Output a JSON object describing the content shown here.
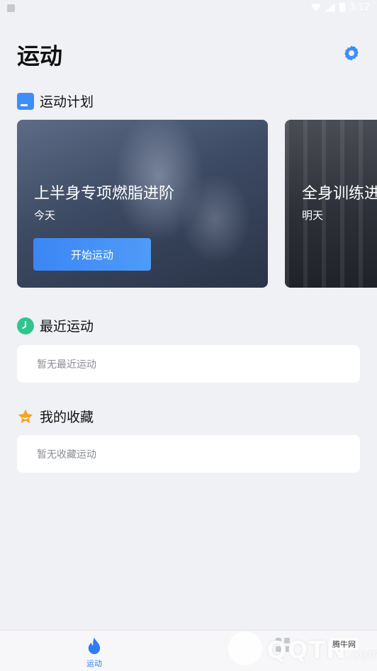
{
  "status_bar": {
    "time": "3:12"
  },
  "header": {
    "title": "运动",
    "settings_icon": "gear-icon"
  },
  "plan_section": {
    "title": "运动计划",
    "icon": "calendar-icon",
    "cards": [
      {
        "title": "上半身专项燃脂进阶",
        "day": "今天",
        "button": "开始运动"
      },
      {
        "title": "全身训练进",
        "day": "明天"
      }
    ]
  },
  "recent_section": {
    "title": "最近运动",
    "icon": "clock-icon",
    "empty_text": "暂无最近运动"
  },
  "favorites_section": {
    "title": "我的收藏",
    "icon": "star-icon",
    "empty_text": "暂无收藏运动"
  },
  "bottom_nav": {
    "tabs": [
      {
        "label": "运动",
        "icon": "flame-icon",
        "active": true
      }
    ]
  },
  "watermark": {
    "text": "QQTN",
    "suffix": ".com",
    "badge": "腾牛网"
  },
  "colors": {
    "accent": "#3d8ef8",
    "background": "#f0f1f5",
    "clock": "#2fc58f",
    "star": "#f5a623"
  }
}
